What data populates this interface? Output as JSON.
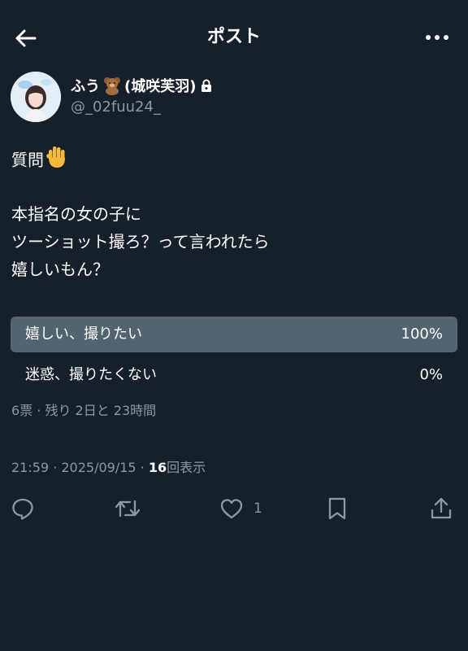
{
  "header": {
    "title": "ポスト"
  },
  "author": {
    "name_prefix": "ふう",
    "name_suffix": "(城咲芙羽)",
    "handle": "@_02fuu24_"
  },
  "post": {
    "line1": "質問",
    "line2": "本指名の女の子に",
    "line3": "ツーショット撮ろ？って言われたら",
    "line4": "嬉しいもん？"
  },
  "poll": {
    "options": [
      {
        "label": "嬉しい、撮りたい",
        "percent_text": "100%",
        "percent": 100
      },
      {
        "label": "迷惑、撮りたくない",
        "percent_text": "0%",
        "percent": 0
      }
    ],
    "meta": "6票 · 残り 2日と 23時間"
  },
  "meta": {
    "time_date": "21:59 · 2025/09/15 · ",
    "views_count": "16",
    "views_label": "回表示"
  },
  "actions": {
    "like_count": "1"
  },
  "colors": {
    "background": "#15202b",
    "muted": "#8b98a5",
    "poll_winner": "#536471"
  }
}
